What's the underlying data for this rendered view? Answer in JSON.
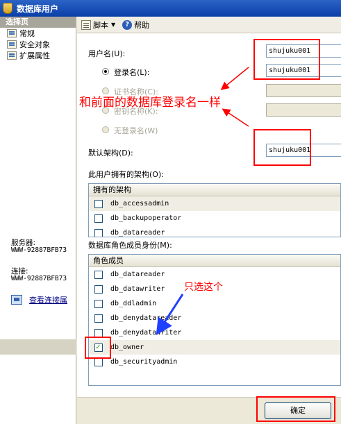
{
  "window": {
    "title": "数据库用户"
  },
  "sidebar": {
    "header": "选择页",
    "items": [
      {
        "label": "常规",
        "icon": "page-icon"
      },
      {
        "label": "安全对象",
        "icon": "page-icon"
      },
      {
        "label": "扩展属性",
        "icon": "page-icon"
      }
    ],
    "server_label": "服务器:",
    "server_value": "WWW-92887BFB73",
    "connection_label": "连接:",
    "connection_value": "WWW-92887BFB73",
    "view_connection_link": "查看连接属"
  },
  "toolbar": {
    "script_label": "脚本",
    "help_label": "帮助"
  },
  "form": {
    "user_name_label": "用户名(U):",
    "user_name_value": "shujuku001",
    "login_name_label": "登录名(L):",
    "login_name_value": "shujuku001",
    "cert_name_label": "证书名称(C):",
    "key_name_label": "密钥名称(K):",
    "no_login_label": "无登录名(W)",
    "default_schema_label": "默认架构(D):",
    "default_schema_value": "shujuku001",
    "owned_schemas_label": "此用户拥有的架构(O):",
    "roles_label": "数据库角色成员身份(M):"
  },
  "owned_schemas": {
    "header": "拥有的架构",
    "rows": [
      {
        "name": "db_accessadmin",
        "checked": false
      },
      {
        "name": "db_backupoperator",
        "checked": false
      },
      {
        "name": "db_datareader",
        "checked": false
      }
    ]
  },
  "roles": {
    "header": "角色成员",
    "rows": [
      {
        "name": "db_datareader",
        "checked": false
      },
      {
        "name": "db_datawriter",
        "checked": false
      },
      {
        "name": "db_ddladmin",
        "checked": false
      },
      {
        "name": "db_denydatareader",
        "checked": false
      },
      {
        "name": "db_denydatawriter",
        "checked": false
      },
      {
        "name": "db_owner",
        "checked": true
      },
      {
        "name": "db_securityadmin",
        "checked": false
      }
    ]
  },
  "annotations": {
    "same_as_login": "和前面的数据库登录名一样",
    "only_select_this": "只选这个",
    "annotation_color": "#ff0000",
    "arrow_color": "#2040ff"
  },
  "footer": {
    "ok_label": "确定"
  }
}
